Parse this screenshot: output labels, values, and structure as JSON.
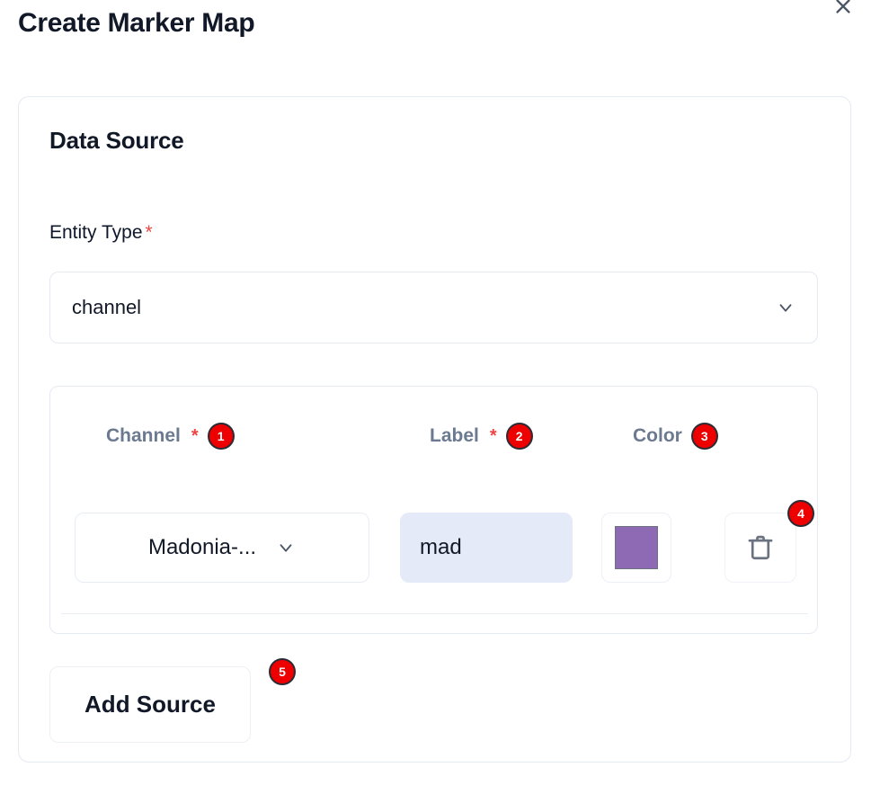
{
  "modal": {
    "title": "Create Marker Map",
    "close_icon": "close-icon"
  },
  "card": {
    "heading": "Data Source",
    "entity_type": {
      "label": "Entity Type",
      "required_marker": "*",
      "value": "channel",
      "chevron_icon": "chevron-down-icon"
    },
    "sources_table": {
      "columns": [
        {
          "label": "Channel",
          "required_marker": "*",
          "badge": "1"
        },
        {
          "label": "Label",
          "required_marker": "*",
          "badge": "2"
        },
        {
          "label": "Color",
          "required_marker": "",
          "badge": "3"
        }
      ],
      "rows": [
        {
          "channel": "Madonia-...",
          "channel_chevron_icon": "chevron-down-icon",
          "label_value": "mad",
          "label_placeholder": "",
          "color": "#8e6ab5",
          "delete_icon": "trash-icon",
          "delete_badge": "4"
        }
      ]
    },
    "add_source": {
      "label": "Add Source",
      "badge": "5"
    }
  },
  "colors": {
    "badge_red": "#ee0000",
    "required_star": "#ef4444",
    "column_header": "#6b7a90",
    "swatch_purple": "#8e6ab5",
    "input_focus_bg": "#e4eaf7",
    "border": "#e5e9f2"
  }
}
